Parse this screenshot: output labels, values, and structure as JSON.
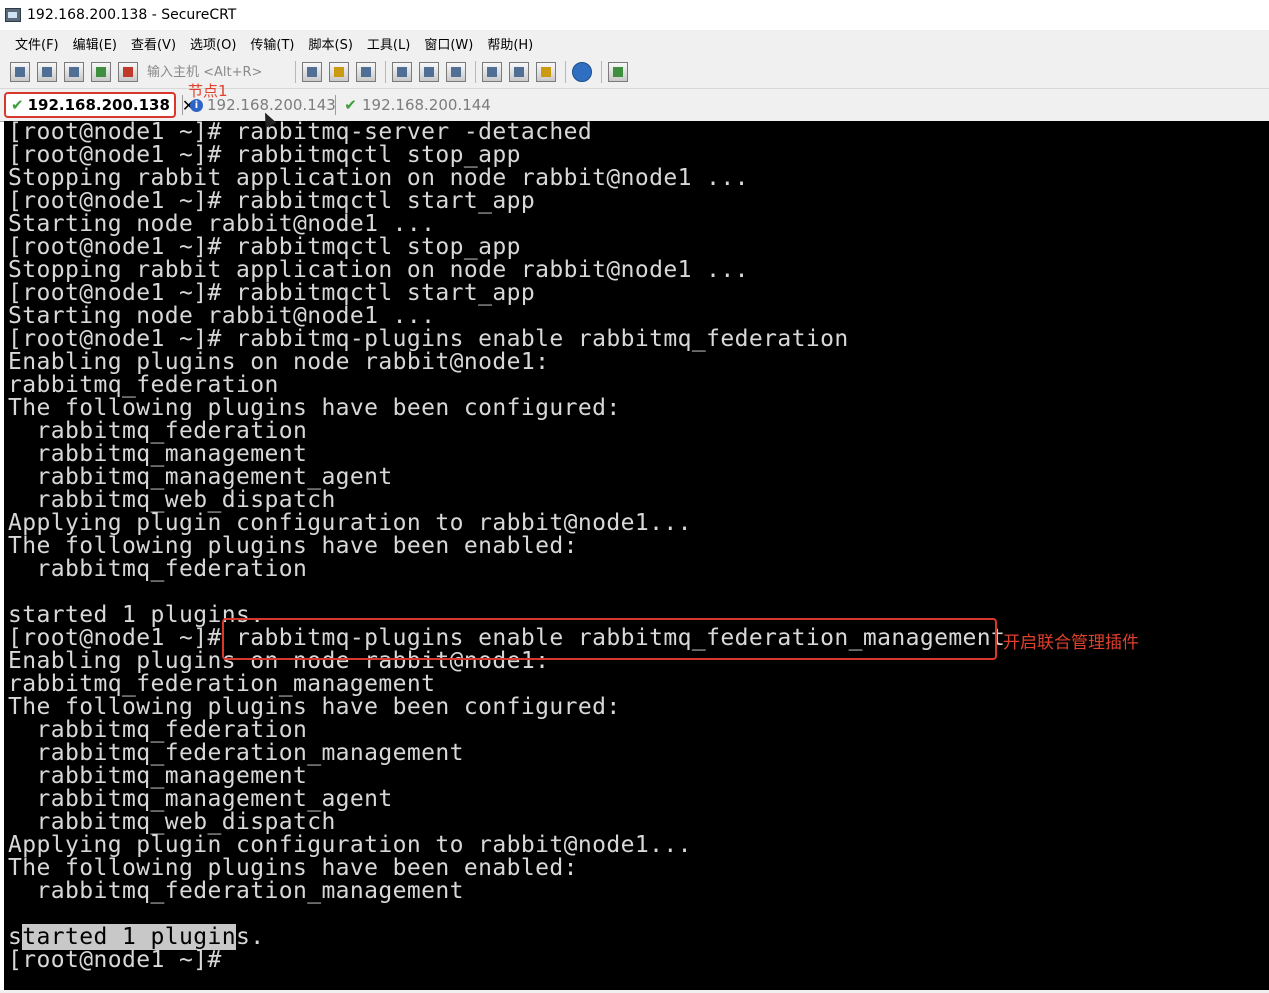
{
  "window": {
    "title": "192.168.200.138 - SecureCRT"
  },
  "menu": [
    "文件(F)",
    "编辑(E)",
    "查看(V)",
    "选项(O)",
    "传输(T)",
    "脚本(S)",
    "工具(L)",
    "窗口(W)",
    "帮助(H)"
  ],
  "toolbar": {
    "host_placeholder": "输入主机 <Alt+R>"
  },
  "tabs": [
    {
      "label": "192.168.200.138",
      "status": "connected"
    },
    {
      "label": "192.168.200.143",
      "status": "info"
    },
    {
      "label": "192.168.200.144",
      "status": "connected"
    }
  ],
  "annotations": {
    "node_label": "节点1",
    "plugin_note": "开启联合管理插件"
  },
  "terminal": {
    "lines": [
      "[root@node1 ~]# rabbitmq-server -detached",
      "[root@node1 ~]# rabbitmqctl stop_app",
      "Stopping rabbit application on node rabbit@node1 ...",
      "[root@node1 ~]# rabbitmqctl start_app",
      "Starting node rabbit@node1 ...",
      "[root@node1 ~]# rabbitmqctl stop_app",
      "Stopping rabbit application on node rabbit@node1 ...",
      "[root@node1 ~]# rabbitmqctl start_app",
      "Starting node rabbit@node1 ...",
      "[root@node1 ~]# rabbitmq-plugins enable rabbitmq_federation",
      "Enabling plugins on node rabbit@node1:",
      "rabbitmq_federation",
      "The following plugins have been configured:",
      "  rabbitmq_federation",
      "  rabbitmq_management",
      "  rabbitmq_management_agent",
      "  rabbitmq_web_dispatch",
      "Applying plugin configuration to rabbit@node1...",
      "The following plugins have been enabled:",
      "  rabbitmq_federation",
      "",
      "started 1 plugins.",
      "[root@node1 ~]# rabbitmq-plugins enable rabbitmq_federation_management",
      "Enabling plugins on node rabbit@node1:",
      "rabbitmq_federation_management",
      "The following plugins have been configured:",
      "  rabbitmq_federation",
      "  rabbitmq_federation_management",
      "  rabbitmq_management",
      "  rabbitmq_management_agent",
      "  rabbitmq_web_dispatch",
      "Applying plugin configuration to rabbit@node1...",
      "The following plugins have been enabled:",
      "  rabbitmq_federation_management",
      ""
    ],
    "final_line": {
      "before": "s",
      "selected": "tarted 1 plugin",
      "after": "s."
    },
    "prompt": "[root@node1 ~]#"
  }
}
